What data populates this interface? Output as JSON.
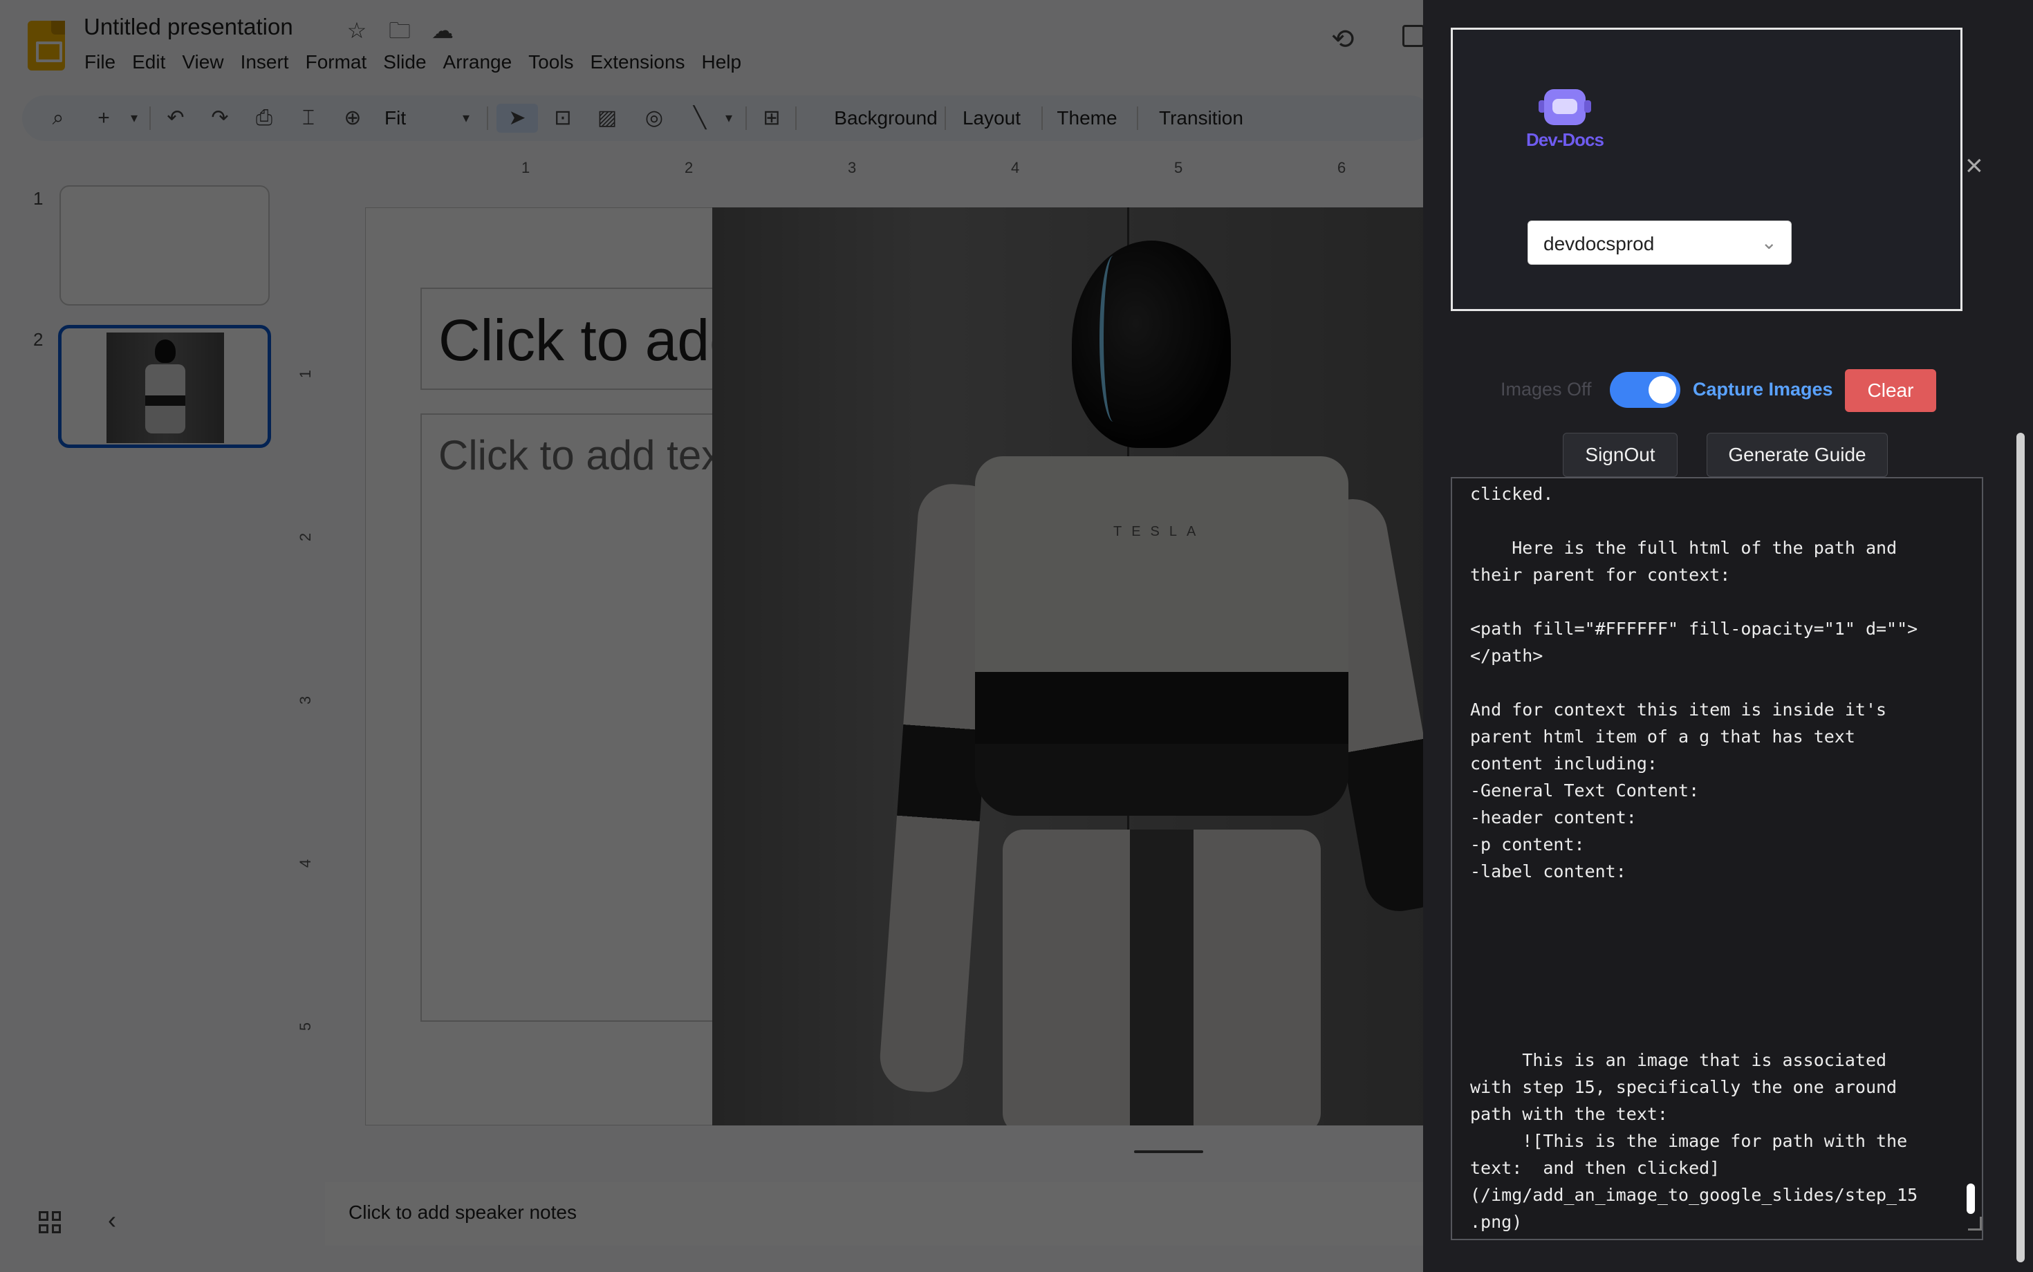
{
  "app": {
    "title": "Untitled presentation",
    "menu": [
      "File",
      "Edit",
      "View",
      "Insert",
      "Format",
      "Slide",
      "Arrange",
      "Tools",
      "Extensions",
      "Help"
    ],
    "toolbar": {
      "zoom": "Fit",
      "background": "Background",
      "layout": "Layout",
      "theme": "Theme",
      "transition": "Transition"
    },
    "ruler_h": [
      "1",
      "2",
      "3",
      "4",
      "5",
      "6"
    ],
    "ruler_v": [
      "1",
      "2",
      "3",
      "4",
      "5"
    ],
    "slides": [
      "1",
      "2"
    ],
    "slide": {
      "title_placeholder": "Click to add title",
      "body_placeholder": "Click to add text",
      "image_logo": "TESLA"
    },
    "notes_placeholder": "Click to add speaker notes"
  },
  "panel": {
    "brand": "Dev-Docs",
    "org": "devdocsprod",
    "images_off": "Images Off",
    "capture_images": "Capture Images",
    "clear": "Clear",
    "signout": "SignOut",
    "generate_guide": "Generate Guide",
    "output": "    Find the path with the text:  and then\nclicked.\n\n    Here is the full html of the path and\ntheir parent for context:\n\n<path fill=\"#FFFFFF\" fill-opacity=\"1\" d=\"\">\n</path>\n\nAnd for context this item is inside it's\nparent html item of a g that has text\ncontent including:\n-General Text Content:\n-header content:\n-p content:\n-label content:\n\n\n\n\n\n\n     This is an image that is associated\nwith step 15, specifically the one around\npath with the text:\n     ![This is the image for path with the\ntext:  and then clicked]\n(/img/add_an_image_to_google_slides/step_15\n.png)",
    "toggle_on": true
  },
  "colors": {
    "accent_blue": "#3b82f6",
    "clear_red": "#e05a5a",
    "brand_purple": "#6f5cf0",
    "selection_blue": "#0b57d0"
  }
}
